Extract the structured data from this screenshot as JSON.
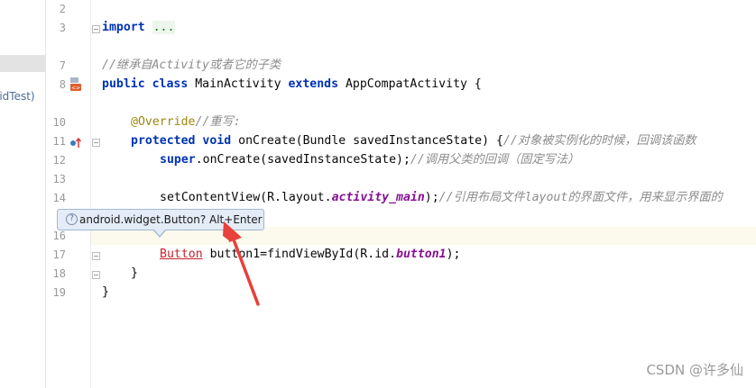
{
  "left_panel": {
    "partial_label": "oidTest)"
  },
  "line_numbers": [
    "2",
    "3",
    "7",
    "8",
    "10",
    "11",
    "12",
    "13",
    "14",
    "16",
    "17",
    "18",
    "19"
  ],
  "code": {
    "l3_kw": "import",
    "l3_fold": "...",
    "l7_comment": "//继承自Activity或者它的子类",
    "l8_kw1": "public",
    "l8_kw2": "class",
    "l8_name": " MainActivity ",
    "l8_kw3": "extends",
    "l8_rest": " AppCompatActivity {",
    "l10_ann": "@Override",
    "l10_comment": "//重写:",
    "l11_kw1": "protected",
    "l11_kw2": "void",
    "l11_rest": " onCreate(Bundle savedInstanceState) {",
    "l11_comment": "//对象被实例化的时候，回调该函数",
    "l12_kw": "super",
    "l12_rest": ".onCreate(savedInstanceState);",
    "l12_comment": "//调用父类的回调（固定写法）",
    "l14_a": "setContentView(R.layout.",
    "l14_field": "activity_main",
    "l14_b": ");",
    "l14_comment": "//引用布局文件layout的界面文件，用来显示界面的",
    "l17_err": "Button",
    "l17_a": " button1=findViewById(R.id.",
    "l17_field": "button1",
    "l17_b": ");",
    "l18": "}",
    "l19": "}"
  },
  "tooltip": {
    "icon": "?",
    "text": "android.widget.Button? Alt+Enter"
  },
  "watermark": "CSDN @许多仙",
  "colors": {
    "keyword": "#0033b3",
    "comment": "#8c8c8c",
    "annotation": "#9e880d",
    "field": "#871094",
    "error": "#c7222d",
    "arrow": "#e8403a"
  },
  "icons": [
    "fold-icon",
    "class-run-icon",
    "override-icon",
    "question-icon"
  ]
}
